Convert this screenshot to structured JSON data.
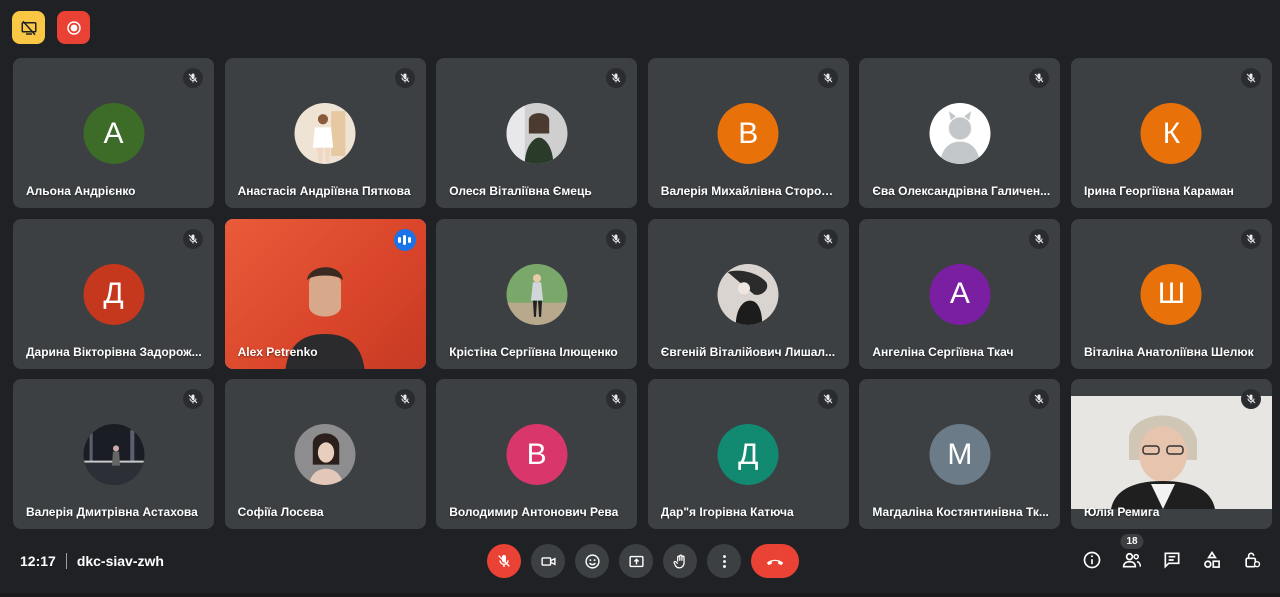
{
  "meeting": {
    "time": "12:17",
    "code": "dkc-siav-zwh",
    "participant_count": "18"
  },
  "colors": {
    "background": "#202124",
    "tile": "#3c4043",
    "end_call": "#ea4335",
    "speaking": "#1a73e8"
  },
  "participants": [
    {
      "name": "Альона Андрієнко",
      "initial": "А",
      "color": "#3d6b28",
      "type": "letter"
    },
    {
      "name": "Анастасія Андріївна Пяткова",
      "type": "photo",
      "photo": "p-light"
    },
    {
      "name": "Олеся Віталіївна Ємець",
      "type": "photo",
      "photo": "p-dark"
    },
    {
      "name": "Валерія Михайлівна Сторож...",
      "initial": "В",
      "color": "#e8710a",
      "type": "letter"
    },
    {
      "name": "Єва Олександрівна Галичен...",
      "type": "default-avatar"
    },
    {
      "name": "Ірина Георгіївна Караман",
      "initial": "К",
      "color": "#e8710a",
      "type": "letter"
    },
    {
      "name": "Дарина Вікторівна Задорож...",
      "initial": "Д",
      "color": "#c5381e",
      "type": "letter"
    },
    {
      "name": "Alex Petrenko",
      "type": "video",
      "speaking": true
    },
    {
      "name": "Крістіна Сергіївна Ілющенко",
      "type": "photo",
      "photo": "p-outdoor"
    },
    {
      "name": "Євгеній Віталійович Лишал...",
      "type": "photo",
      "photo": "p-art"
    },
    {
      "name": "Ангеліна Сергіївна Ткач",
      "initial": "А",
      "color": "#7b1fa2",
      "type": "letter"
    },
    {
      "name": "Віталіна Анатоліївна Шелюк",
      "initial": "Ш",
      "color": "#e8710a",
      "type": "letter"
    },
    {
      "name": "Валерія Дмитрівна Астахова",
      "type": "photo",
      "photo": "p-night"
    },
    {
      "name": "Софіїа Лосєва",
      "type": "photo",
      "photo": "p-portrait"
    },
    {
      "name": "Володимир Антонович Рева",
      "initial": "В",
      "color": "#d9366c",
      "type": "letter"
    },
    {
      "name": "Дар\"я Ігорівна Катюча",
      "initial": "Д",
      "color": "#128a71",
      "type": "letter"
    },
    {
      "name": "Магдаліна Костянтинівна Тк...",
      "initial": "М",
      "color": "#6b7b87",
      "type": "letter"
    },
    {
      "name": "Юлія Ремига",
      "type": "video2"
    }
  ],
  "icons": {
    "badges": [
      "presentation-off-icon",
      "record-icon"
    ],
    "controls": [
      "mic-off-icon",
      "camera-icon",
      "emoji-icon",
      "present-icon",
      "raise-hand-icon",
      "more-icon",
      "end-call-icon"
    ],
    "right": [
      "info-icon",
      "people-icon",
      "chat-icon",
      "activities-icon",
      "host-controls-icon"
    ]
  }
}
